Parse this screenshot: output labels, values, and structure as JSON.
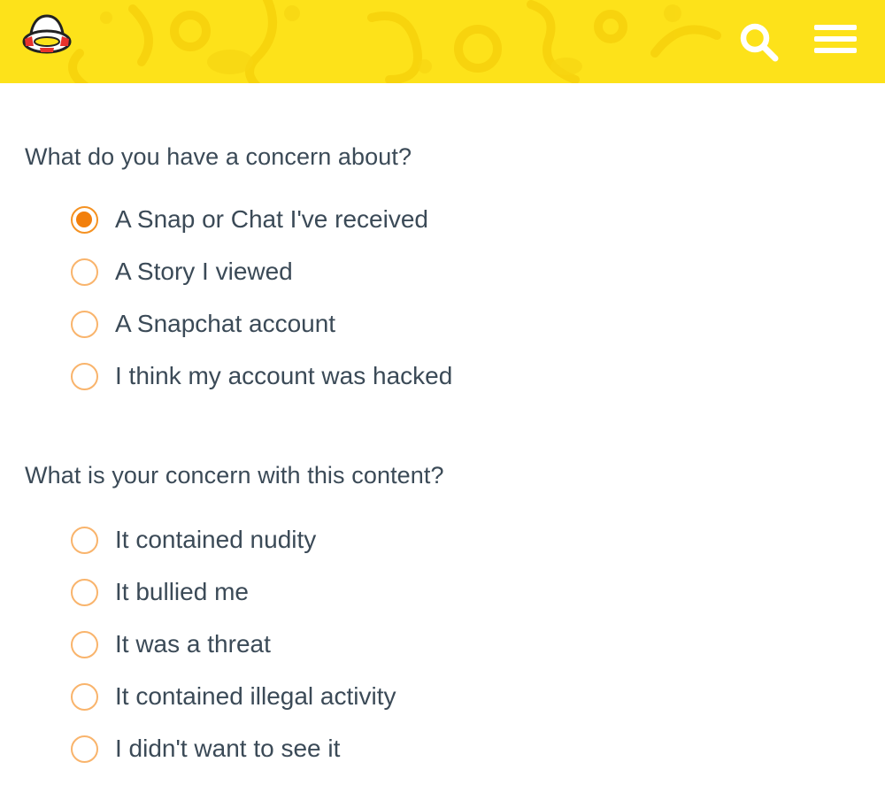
{
  "header": {
    "brand_icon": "ghost-lifebuoy-icon",
    "search_icon": "search-icon",
    "menu_icon": "hamburger-menu-icon",
    "background_color": "#fde21a",
    "pattern_color": "#f6d10c"
  },
  "form": {
    "accent_color": "#f59222",
    "question1": {
      "label": "What do you have a concern about?",
      "options": [
        {
          "label": "A Snap or Chat I've received",
          "checked": true
        },
        {
          "label": "A Story I viewed",
          "checked": false
        },
        {
          "label": "A Snapchat account",
          "checked": false
        },
        {
          "label": "I think my account was hacked",
          "checked": false
        }
      ]
    },
    "question2": {
      "label": "What is your concern with this content?",
      "options": [
        {
          "label": "It contained nudity",
          "checked": false
        },
        {
          "label": "It bullied me",
          "checked": false
        },
        {
          "label": "It was a threat",
          "checked": false
        },
        {
          "label": "It contained illegal activity",
          "checked": false
        },
        {
          "label": "I didn't want to see it",
          "checked": false
        }
      ]
    }
  }
}
